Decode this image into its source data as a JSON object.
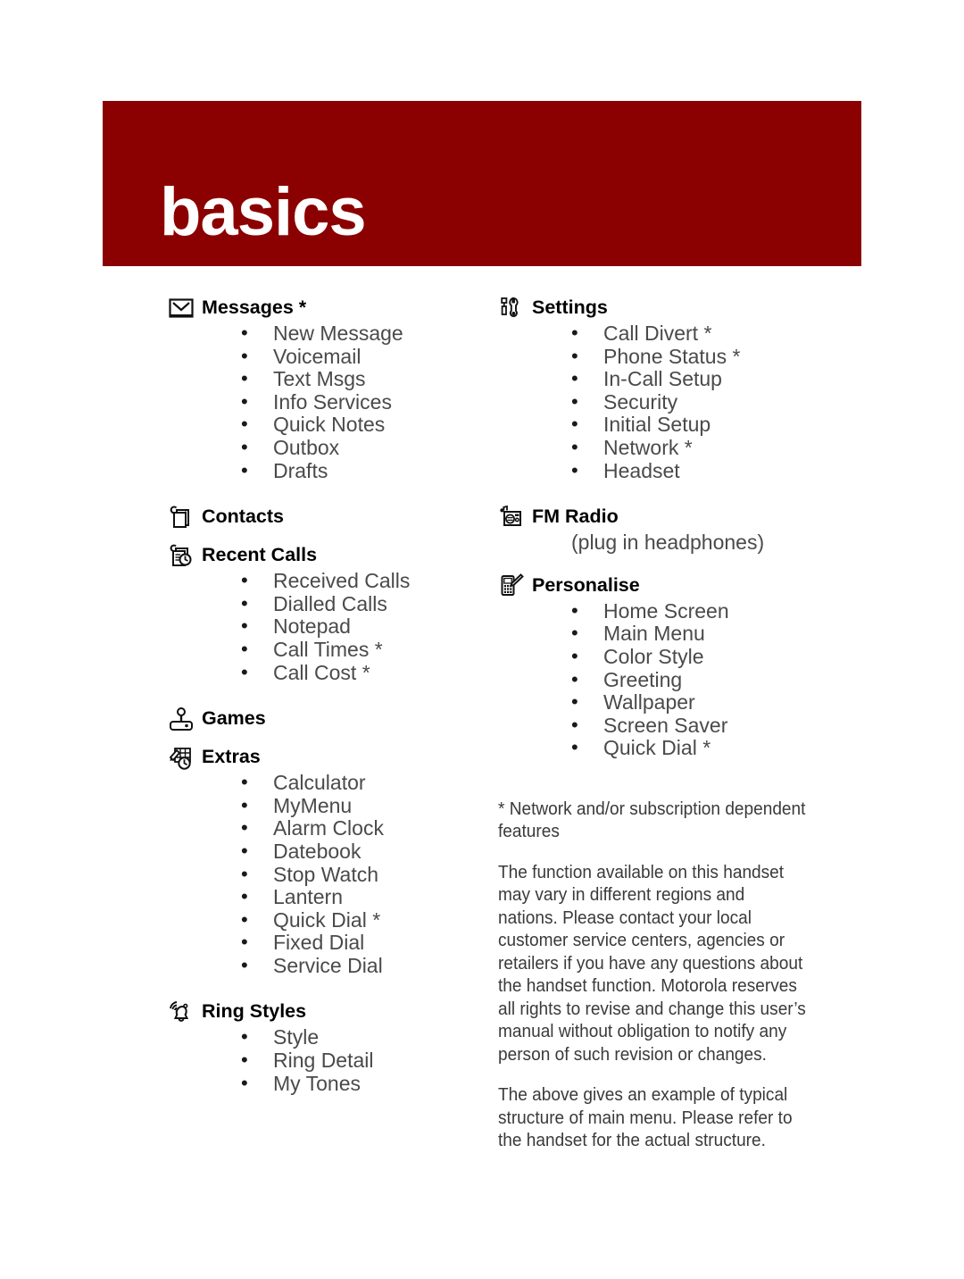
{
  "banner": {
    "title": "basics",
    "color": "#8b0000"
  },
  "colors": {
    "banner_red": "#8b0000",
    "heading_black": "#000000",
    "list_gray": "#4a4a4a",
    "body_gray": "#3a3a3a"
  },
  "left_column": {
    "sections": [
      {
        "icon": "envelope-icon",
        "title": "Messages *",
        "items": [
          "New Message",
          "Voicemail",
          "Text Msgs",
          "Info Services",
          "Quick Notes",
          "Outbox",
          "Drafts"
        ]
      },
      {
        "icon": "contacts-card-icon",
        "title": "Contacts",
        "items": []
      },
      {
        "icon": "recent-calls-clock-icon",
        "title": "Recent Calls",
        "items": [
          "Received Calls",
          "Dialled Calls",
          "Notepad",
          "Call Times *",
          "Call Cost *"
        ]
      },
      {
        "icon": "joystick-icon",
        "title": "Games",
        "items": []
      },
      {
        "icon": "extras-calculator-pencil-icon",
        "title": "Extras",
        "items": [
          "Calculator",
          "MyMenu",
          "Alarm Clock",
          "Datebook",
          "Stop Watch",
          "Lantern",
          "Quick Dial *",
          "Fixed Dial",
          "Service Dial"
        ]
      },
      {
        "icon": "ringing-bell-icon",
        "title": "Ring Styles",
        "items": [
          "Style",
          "Ring Detail",
          "My Tones"
        ]
      }
    ]
  },
  "right_column": {
    "sections": [
      {
        "icon": "screwdriver-wrench-icon",
        "title": "Settings",
        "items": [
          "Call Divert *",
          "Phone Status *",
          "In-Call Setup",
          "Security",
          "Initial Setup",
          "Network *",
          "Headset"
        ]
      },
      {
        "icon": "fm-radio-icon",
        "title": "FM Radio",
        "subnote": "(plug in headphones)",
        "items": []
      },
      {
        "icon": "phone-pencil-icon",
        "title": "Personalise",
        "items": [
          "Home Screen",
          "Main Menu",
          "Color Style",
          "Greeting",
          "Wallpaper",
          "Screen Saver",
          "Quick Dial *"
        ]
      }
    ],
    "footnote": "* Network and/or subscription dependent features",
    "paragraphs": [
      "The function available on this handset may vary in different regions and nations. Please contact your local customer service centers, agencies or retailers if you have any questions about the handset function. Motorola reserves all rights to revise and change this user’s manual without obligation to notify any person of such revision or changes.",
      "The above gives an example of typical structure of main menu. Please refer to the handset for the actual structure."
    ]
  }
}
